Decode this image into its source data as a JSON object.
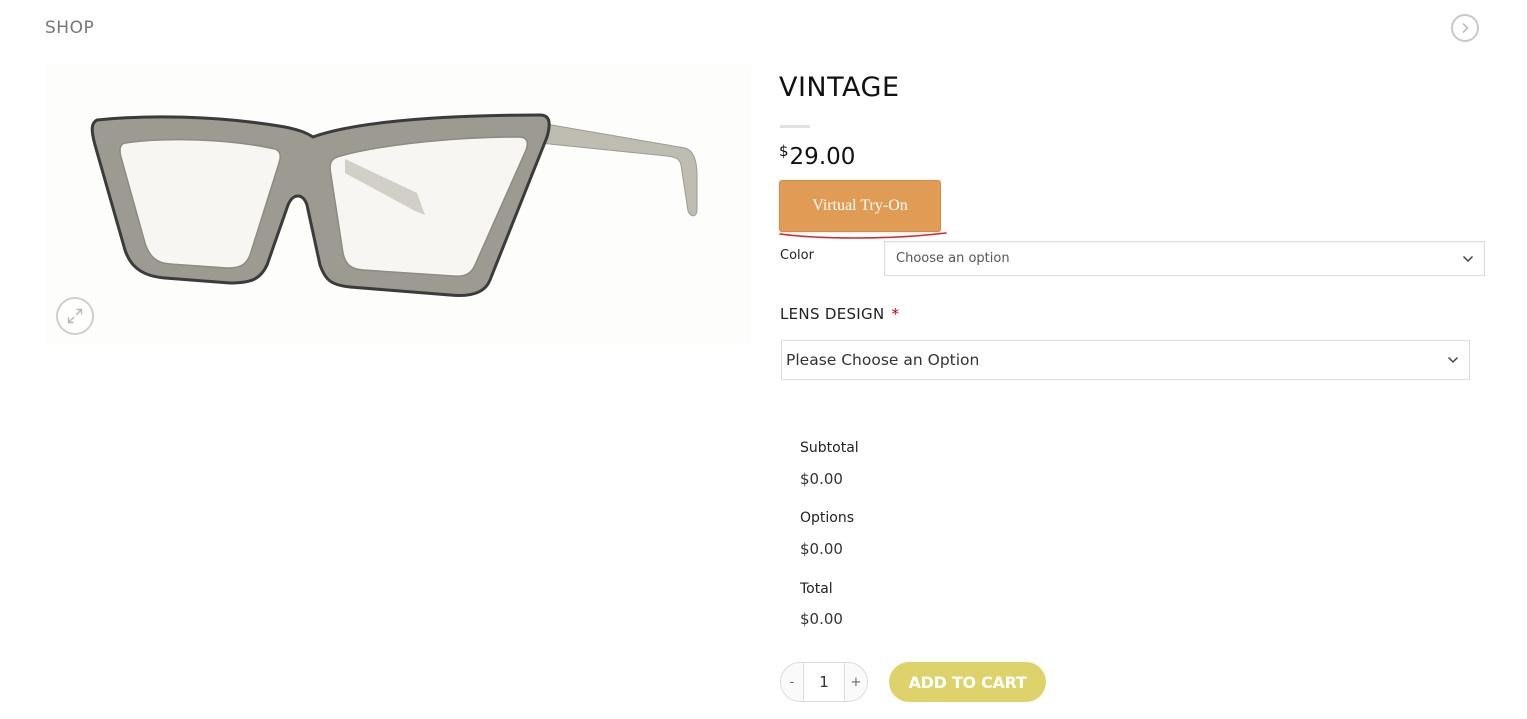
{
  "breadcrumb": {
    "label": "SHOP"
  },
  "nav": {
    "next_icon": "chevron-right-icon"
  },
  "product": {
    "title": "VINTAGE",
    "price_currency": "$",
    "price_amount": "29.00",
    "image_alt_icon": "eyeglasses-image",
    "zoom_icon": "expand-icon"
  },
  "tryon": {
    "label": "Virtual Try-On",
    "color": "#e09c54"
  },
  "color_select": {
    "label": "Color",
    "value": "Choose an option"
  },
  "lens_design": {
    "label": "LENS DESIGN",
    "required_mark": "*",
    "value": "Please Choose an Option"
  },
  "totals": {
    "subtotal_label": "Subtotal",
    "subtotal_value": "$0.00",
    "options_label": "Options",
    "options_value": "$0.00",
    "total_label": "Total",
    "total_value": "$0.00"
  },
  "quantity": {
    "minus": "-",
    "value": "1",
    "plus": "+"
  },
  "cart": {
    "label": "ADD TO CART",
    "color": "#ddd36a"
  }
}
